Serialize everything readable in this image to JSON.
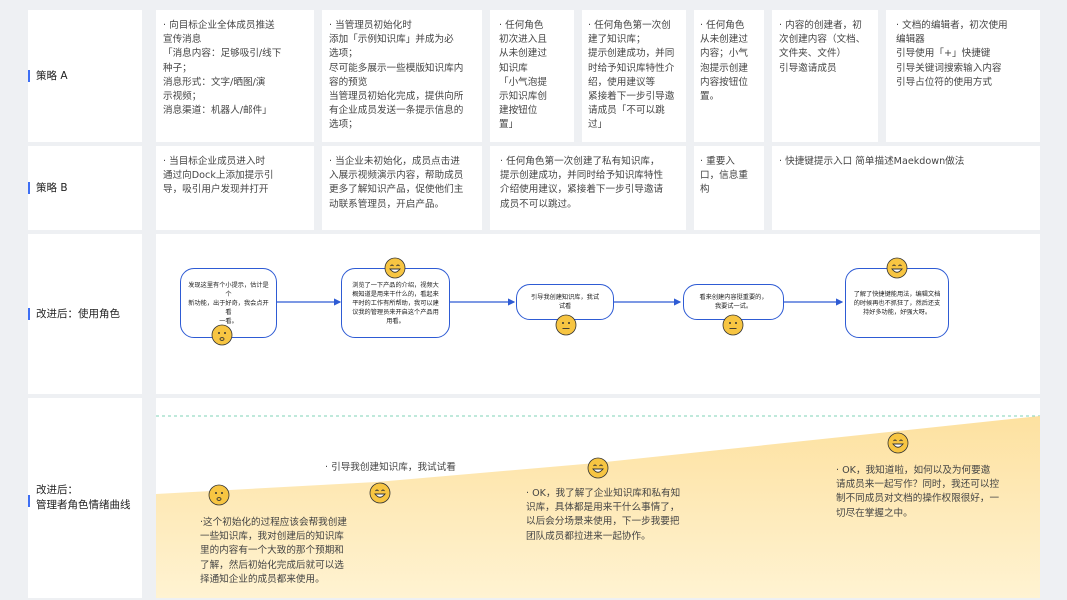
{
  "rows": {
    "strategyA": "策略 A",
    "strategyB": "策略 B",
    "afterUser": "改进后：使用角色",
    "afterAdmin": "改进后：\n管理者角色情绪曲线"
  },
  "strategyA": [
    "· 向目标企业全体成员推送\n宣传消息\n「消息内容：足够吸引/线下\n种子；\n  消息形式：文字/晒图/演\n示视频；\n  消息渠道：机器人/邮件」",
    "· 当管理员初始化时\n添加「示例知识库」并成为必\n选项；\n尽可能多展示一些模版知识库内\n容的预览\n当管理员初始化完成，提供向所\n有企业成员发送一条提示信息的\n选项；",
    "· 任何角色\n初次进入且\n从未创建过\n知识库\n「小气泡提\n示知识库创\n建按钮位\n置」",
    "· 任何角色第一次创\n建了知识库；\n提示创建成功，并同\n时给予知识库特性介\n绍，使用建议等\n紧接着下一步引导邀\n请成员「不可以跳\n过」",
    "· 任何角色\n从未创建过\n内容；小气\n泡提示创建\n内容按钮位\n置。",
    "· 内容的创建者，初\n次创建内容（文档、\n文件夹、文件）\n引导邀请成员",
    "· 文档的编辑者，初次使用\n编辑器\n引导使用「+」快捷键\n引导关键词搜索输入内容\n引导占位符的使用方式"
  ],
  "strategyB": [
    "· 当目标企业成员进入时\n通过向Dock上添加提示引\n导，吸引用户发现并打开",
    "· 当企业未初始化，成员点击进\n入展示视频演示内容，帮助成员\n更多了解知识产品，促使他们主\n动联系管理员，开启产品。",
    "· 任何角色第一次创建了私有知识库，\n提示创建成功，并同时给予知识库特性\n介绍使用建议，紧接着下一步引导邀请\n成员不可以跳过。",
    "· 重要入\n口，信息重\n构",
    "· 快捷键提示入口  简单描述Maekdown做法"
  ],
  "userFlow": [
    "发现这里有个小提示，估计是个\n新功能，出于好奇，我会点开看\n一看。",
    "浏览了一下产品的介绍，视频大\n概知道是用来干什么的，看起来\n平时的工作有所帮助，我可以建\n议我的管理员来开启这个产品用\n用看。",
    "引导我创建知识库，我试\n试看",
    "看来创建内容挺重要的，\n我要试一试。",
    "了解了快捷键能用法，编辑文档\n的时候再也不抓狂了，然后还支\n持好多功能，好强大呀。"
  ],
  "adminMood": [
    "·这个初始化的过程应该会帮我创建\n一些知识库，我对创建后的知识库\n里的内容有一个大致的那个预期和\n了解，然后初始化完成后就可以选\n择通知企业的成员都来使用。",
    "· 引导我创建知识库，我试试看",
    "· OK，我了解了企业知识库和私有知\n识库，具体都是用来干什么事情了，\n以后会分场景来使用，下一步我要把\n团队成员都拉进来一起协作。",
    "· OK，我知道啦，如何以及为何要邀\n请成员来一起写作？同时，我还可以控\n制不同成员对文档的操作权限很好，一\n切尽在掌握之中。"
  ],
  "colors": {
    "accent": "#3e6ff4",
    "flowBorder": "#2e5bd4",
    "emoji": "#f7c542",
    "area": "#fde7a6",
    "dashed": "#7fd3b7"
  }
}
